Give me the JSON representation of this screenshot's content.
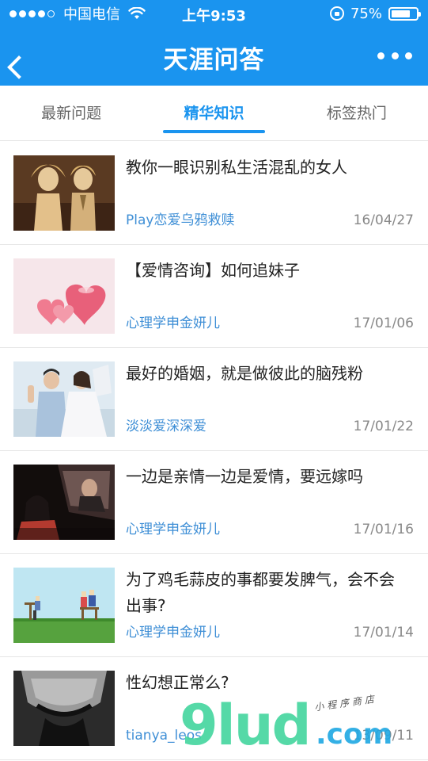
{
  "status_bar": {
    "carrier": "中国电信",
    "time": "上午9:53",
    "battery": "75%",
    "battery_level": 0.75,
    "signal_filled": 4
  },
  "nav": {
    "title": "天涯问答"
  },
  "tabs": [
    {
      "label": "最新问题",
      "active": false
    },
    {
      "label": "精华知识",
      "active": true
    },
    {
      "label": "标签热门",
      "active": false
    }
  ],
  "items": [
    {
      "title": "教你一眼识别私生活混乱的女人",
      "author": "Play恋爱乌鸦救赎",
      "date": "16/04/27"
    },
    {
      "title": "【爱情咨询】如何追妹子",
      "author": "心理学申金妍儿",
      "date": "17/01/06"
    },
    {
      "title": "最好的婚姻，就是做彼此的脑残粉",
      "author": "淡淡爱深深爱",
      "date": "17/01/22"
    },
    {
      "title": "一边是亲情一边是爱情，要远嫁吗",
      "author": "心理学申金妍儿",
      "date": "17/01/16"
    },
    {
      "title": "为了鸡毛蒜皮的事都要发脾气，会不会出事?",
      "author": "心理学申金妍儿",
      "date": "17/01/14"
    },
    {
      "title": "性幻想正常么?",
      "author": "tianya_leos",
      "date": "13/09/11"
    }
  ],
  "watermark": {
    "main": "9lud",
    "suffix": ".com",
    "tagline": "小程序商店"
  },
  "colors": {
    "header": "#1a94ef",
    "accent": "#1a94ef",
    "author": "#3f8fd6"
  }
}
